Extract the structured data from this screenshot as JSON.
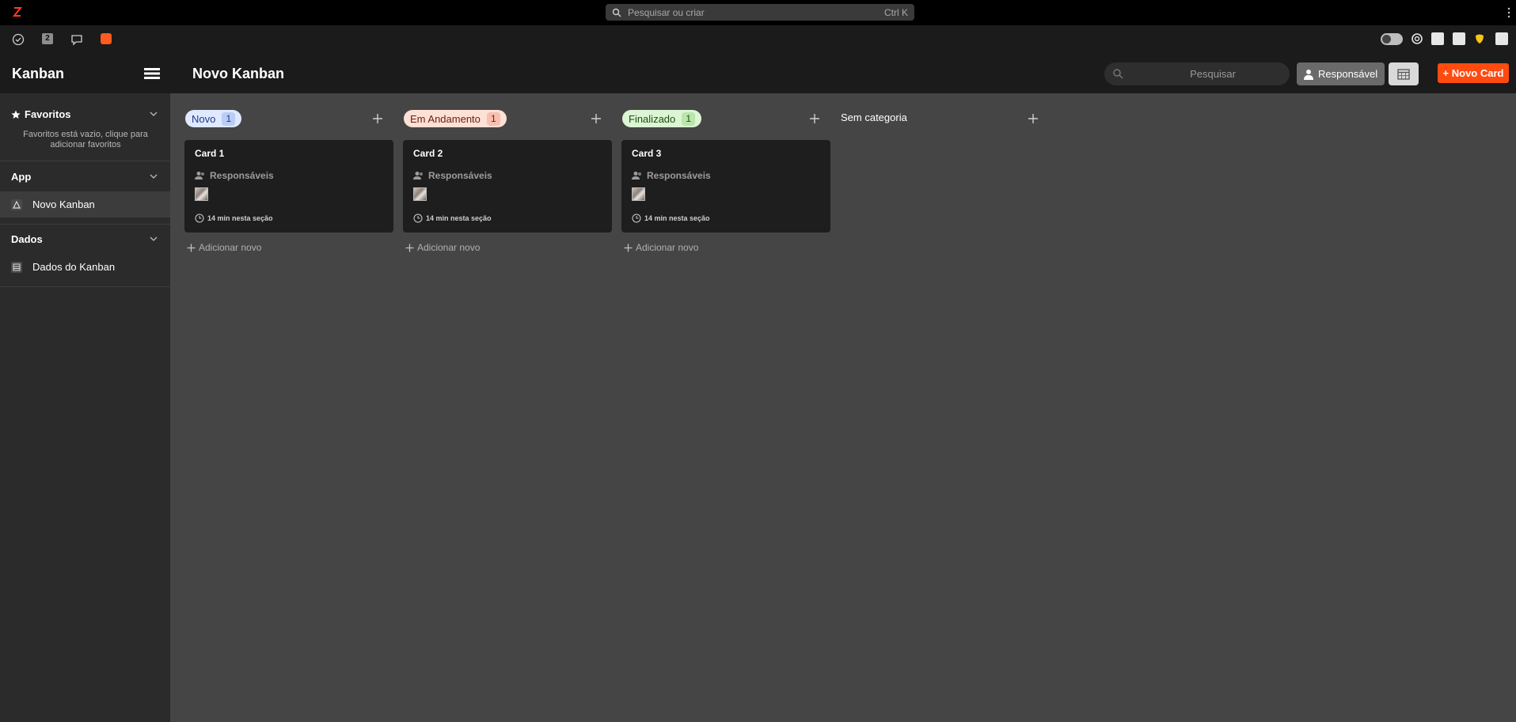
{
  "topbar": {
    "logo_icon": "app-logo-icon",
    "search_placeholder": "Pesquisar ou criar",
    "search_shortcut": "Ctrl K",
    "menu_icon": "kebab-menu-icon"
  },
  "iconbar": {
    "tasks_icon": "check-circle-icon",
    "notification_count": "2",
    "chat_icon": "chat-bubble-icon",
    "brand_icon": "orange-app-icon"
  },
  "header": {
    "app_title": "Kanban",
    "page_title": "Novo Kanban",
    "search_placeholder": "Pesquisar",
    "responsavel_label": "Responsável",
    "new_card_label": "+ Novo Card"
  },
  "sidebar": {
    "favorites_title": "Favoritos",
    "favorites_empty": "Favoritos está vazio, clique para adicionar favoritos",
    "app_title": "App",
    "app_items": [
      {
        "label": "Novo Kanban",
        "icon": "kanban-icon"
      }
    ],
    "data_title": "Dados",
    "data_items": [
      {
        "label": "Dados do Kanban",
        "icon": "table-icon"
      }
    ]
  },
  "board": {
    "columns": [
      {
        "name": "Novo",
        "count": "1",
        "bg": "#dfe9ff",
        "fg": "#1d3a8a",
        "cnt_bg": "#b9cdf7"
      },
      {
        "name": "Em Andamento",
        "count": "1",
        "bg": "#fde0d6",
        "fg": "#6b1f0c",
        "cnt_bg": "#f7bfae"
      },
      {
        "name": "Finalizado",
        "count": "1",
        "bg": "#dcf5d4",
        "fg": "#1e4d12",
        "cnt_bg": "#b9e6ab"
      },
      {
        "name": "Sem categoria"
      }
    ],
    "cards": [
      {
        "title": "Card 1",
        "responsible_label": "Responsáveis",
        "time": "14 min nesta seção"
      },
      {
        "title": "Card 2",
        "responsible_label": "Responsáveis",
        "time": "14 min nesta seção"
      },
      {
        "title": "Card 3",
        "responsible_label": "Responsáveis",
        "time": "14 min nesta seção"
      }
    ],
    "add_new_label": "Adicionar novo"
  },
  "colors": {
    "accent": "#ff4a10",
    "sidebar_bg": "#2b2b2b",
    "header_bg": "#1b1b1b",
    "board_bg": "#454545",
    "card_bg": "#1e1e1e"
  }
}
